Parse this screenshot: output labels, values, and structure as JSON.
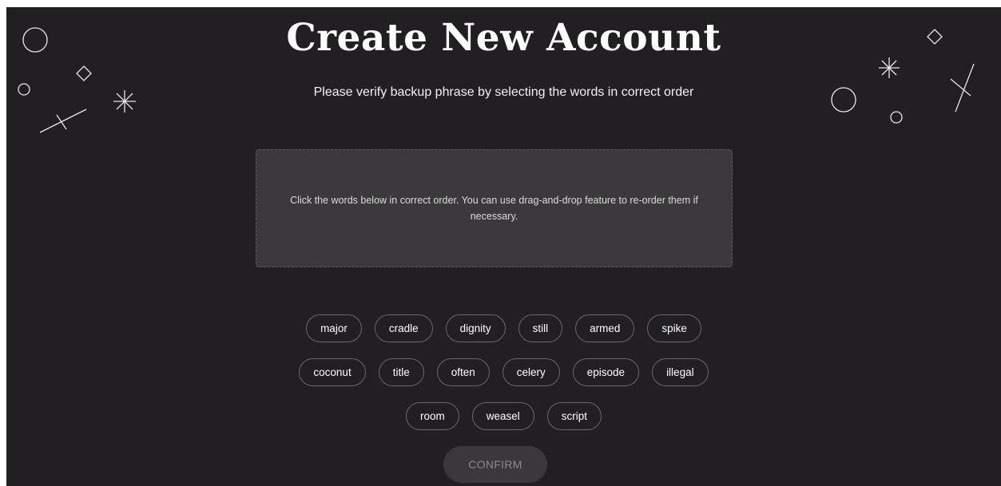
{
  "header": {
    "title": "Create New Account",
    "subtitle": "Please verify backup phrase by selecting the words in correct order"
  },
  "dropzone": {
    "hint": "Click the words below in correct order. You can use drag-and-drop feature to re-order them if necessary."
  },
  "word_rows": [
    [
      "major",
      "cradle",
      "dignity",
      "still",
      "armed",
      "spike"
    ],
    [
      "coconut",
      "title",
      "often",
      "celery",
      "episode",
      "illegal"
    ],
    [
      "room",
      "weasel",
      "script"
    ]
  ],
  "actions": {
    "confirm_label": "CONFIRM"
  },
  "colors": {
    "background": "#221f22",
    "dropzone": "#3b393b",
    "chip_border": "#6a676a",
    "confirm_disabled": "#3a383a"
  }
}
